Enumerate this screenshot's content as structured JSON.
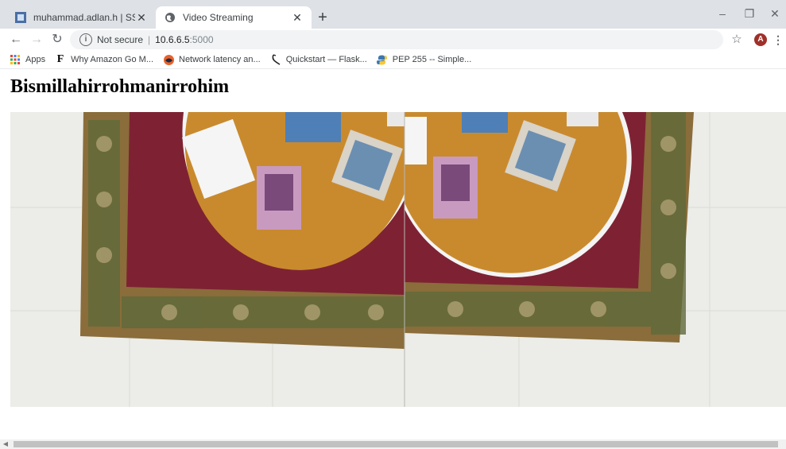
{
  "browser": {
    "tabs": [
      {
        "title": "muhammad.adlan.h | SSO Status",
        "icon": "sso-favicon",
        "active": false
      },
      {
        "title": "Video Streaming",
        "icon": "globe-icon",
        "active": true
      }
    ],
    "address": {
      "security_label": "Not secure",
      "host": "10.6.6.5",
      "port": ":5000"
    },
    "avatar_letter": "A",
    "bookmarks": [
      {
        "label": "Apps",
        "icon": "apps-grid-icon"
      },
      {
        "label": "Why Amazon Go M...",
        "icon": "f-logo-icon"
      },
      {
        "label": "Network latency an...",
        "icon": "network-icon"
      },
      {
        "label": "Quickstart — Flask...",
        "icon": "flask-icon"
      },
      {
        "label": "PEP 255 -- Simple...",
        "icon": "python-icon"
      }
    ]
  },
  "page": {
    "heading": "Bismillahirrohmanirrohim",
    "video_alt": "Live camera feed: overhead view of a round table with magazines on a red patterned carpet"
  },
  "colors": {
    "tabstrip": "#dee1e6",
    "carpet": "#7e2233",
    "table": "#c98a2e",
    "floor": "#ecece8"
  }
}
